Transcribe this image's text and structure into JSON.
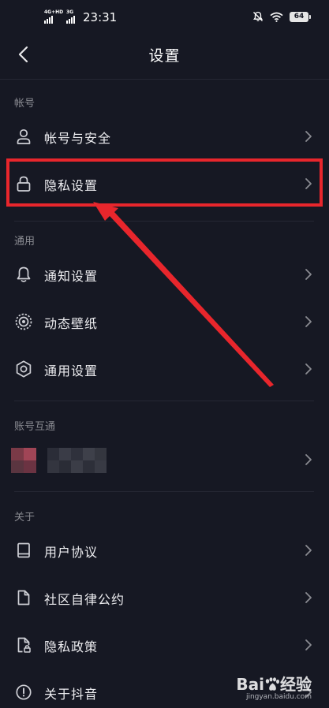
{
  "status_bar": {
    "signal1": "4G+HD",
    "signal2": "3G",
    "time": "23:31",
    "battery": "64"
  },
  "nav": {
    "title": "设置"
  },
  "sections": {
    "account": {
      "header": "帐号",
      "items": [
        {
          "label": "帐号与安全",
          "icon": "user-icon"
        },
        {
          "label": "隐私设置",
          "icon": "lock-icon"
        }
      ]
    },
    "general": {
      "header": "通用",
      "items": [
        {
          "label": "通知设置",
          "icon": "bell-icon"
        },
        {
          "label": "动态壁纸",
          "icon": "wallpaper-icon"
        },
        {
          "label": "通用设置",
          "icon": "gear-icon"
        }
      ]
    },
    "linked": {
      "header": "账号互通"
    },
    "about": {
      "header": "关于",
      "items": [
        {
          "label": "用户协议",
          "icon": "book-icon"
        },
        {
          "label": "社区自律公约",
          "icon": "document-icon"
        },
        {
          "label": "隐私政策",
          "icon": "privacy-document-icon"
        },
        {
          "label": "关于抖音",
          "icon": "info-icon"
        }
      ]
    }
  },
  "watermark": {
    "brand": "Bai",
    "brand_tail": "经验",
    "url": "jingyan.baidu.com"
  },
  "colors": {
    "background": "#161823",
    "highlight": "#e8262c",
    "arrow": "#e8262c"
  }
}
